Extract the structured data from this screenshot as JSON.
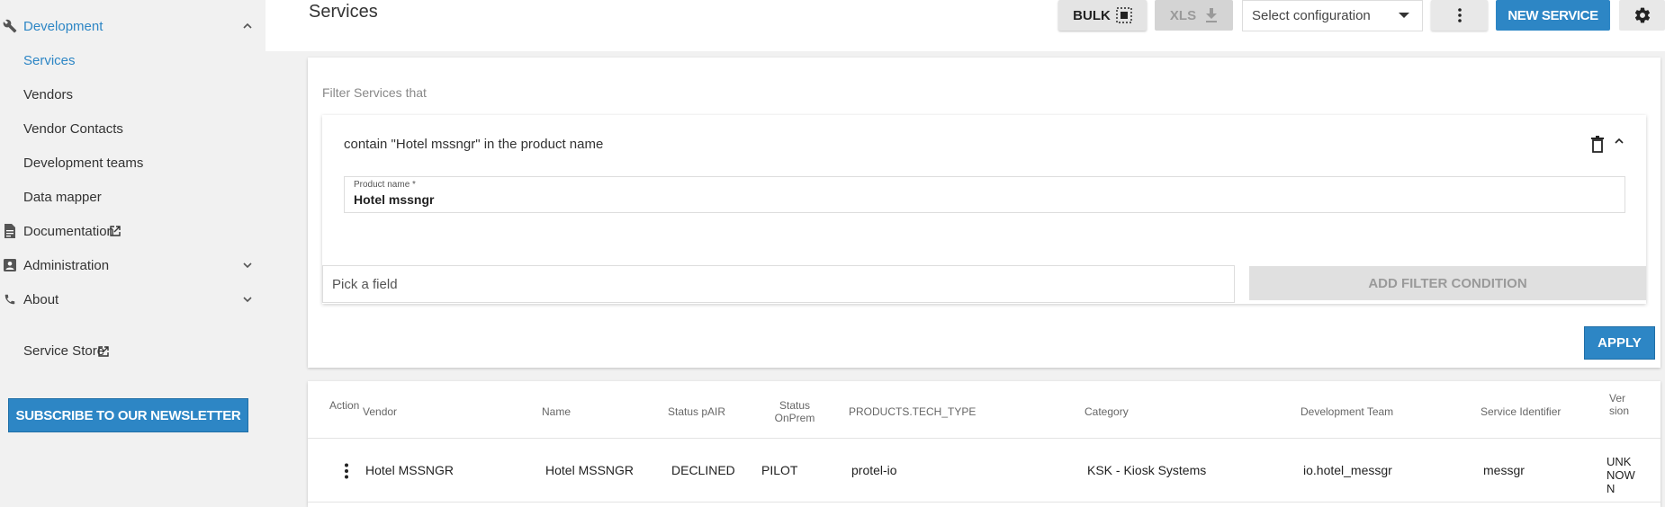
{
  "sidebar": {
    "items": [
      {
        "label": "Development"
      },
      {
        "label": "Services"
      },
      {
        "label": "Vendors"
      },
      {
        "label": "Vendor Contacts"
      },
      {
        "label": "Development teams"
      },
      {
        "label": "Data mapper"
      },
      {
        "label": "Documentation"
      },
      {
        "label": "Administration"
      },
      {
        "label": "About"
      },
      {
        "label": "Service Store"
      }
    ],
    "newsletter_label": "SUBSCRIBE TO OUR NEWSLETTER"
  },
  "header": {
    "title": "Services",
    "bulk_label": "BULK",
    "xls_label": "XLS",
    "config_placeholder": "Select configuration",
    "new_service_label": "NEW SERVICE"
  },
  "filter": {
    "heading": "Filter Services that",
    "condition_text": "contain \"Hotel mssngr\" in the product name",
    "field_label": "Product name *",
    "field_value": "Hotel mssngr",
    "pick_placeholder": "Pick a field",
    "add_condition_label": "ADD FILTER CONDITION",
    "apply_label": "APPLY"
  },
  "table": {
    "headers": {
      "action": "Action",
      "vendor": "Vendor",
      "name": "Name",
      "status_pair": "Status pAIR",
      "status_onprem": "Status OnPrem",
      "tech_type": "PRODUCTS.TECH_TYPE",
      "category": "Category",
      "dev_team": "Development Team",
      "service_id": "Service Identifier",
      "version": "Version"
    },
    "rows": [
      {
        "vendor": "Hotel MSSNGR",
        "name": "Hotel MSSNGR",
        "status_pair": "DECLINED",
        "status_onprem": "PILOT",
        "tech_type": "protel-io",
        "category": "KSK - Kiosk Systems",
        "dev_team": "io.hotel_messgr",
        "service_id": "messgr",
        "version": "UNKNOWN"
      }
    ]
  },
  "colors": {
    "accent": "#2d86c5",
    "sidebar_bg": "#f1f1f1",
    "disabled": "#e0e0e0"
  }
}
